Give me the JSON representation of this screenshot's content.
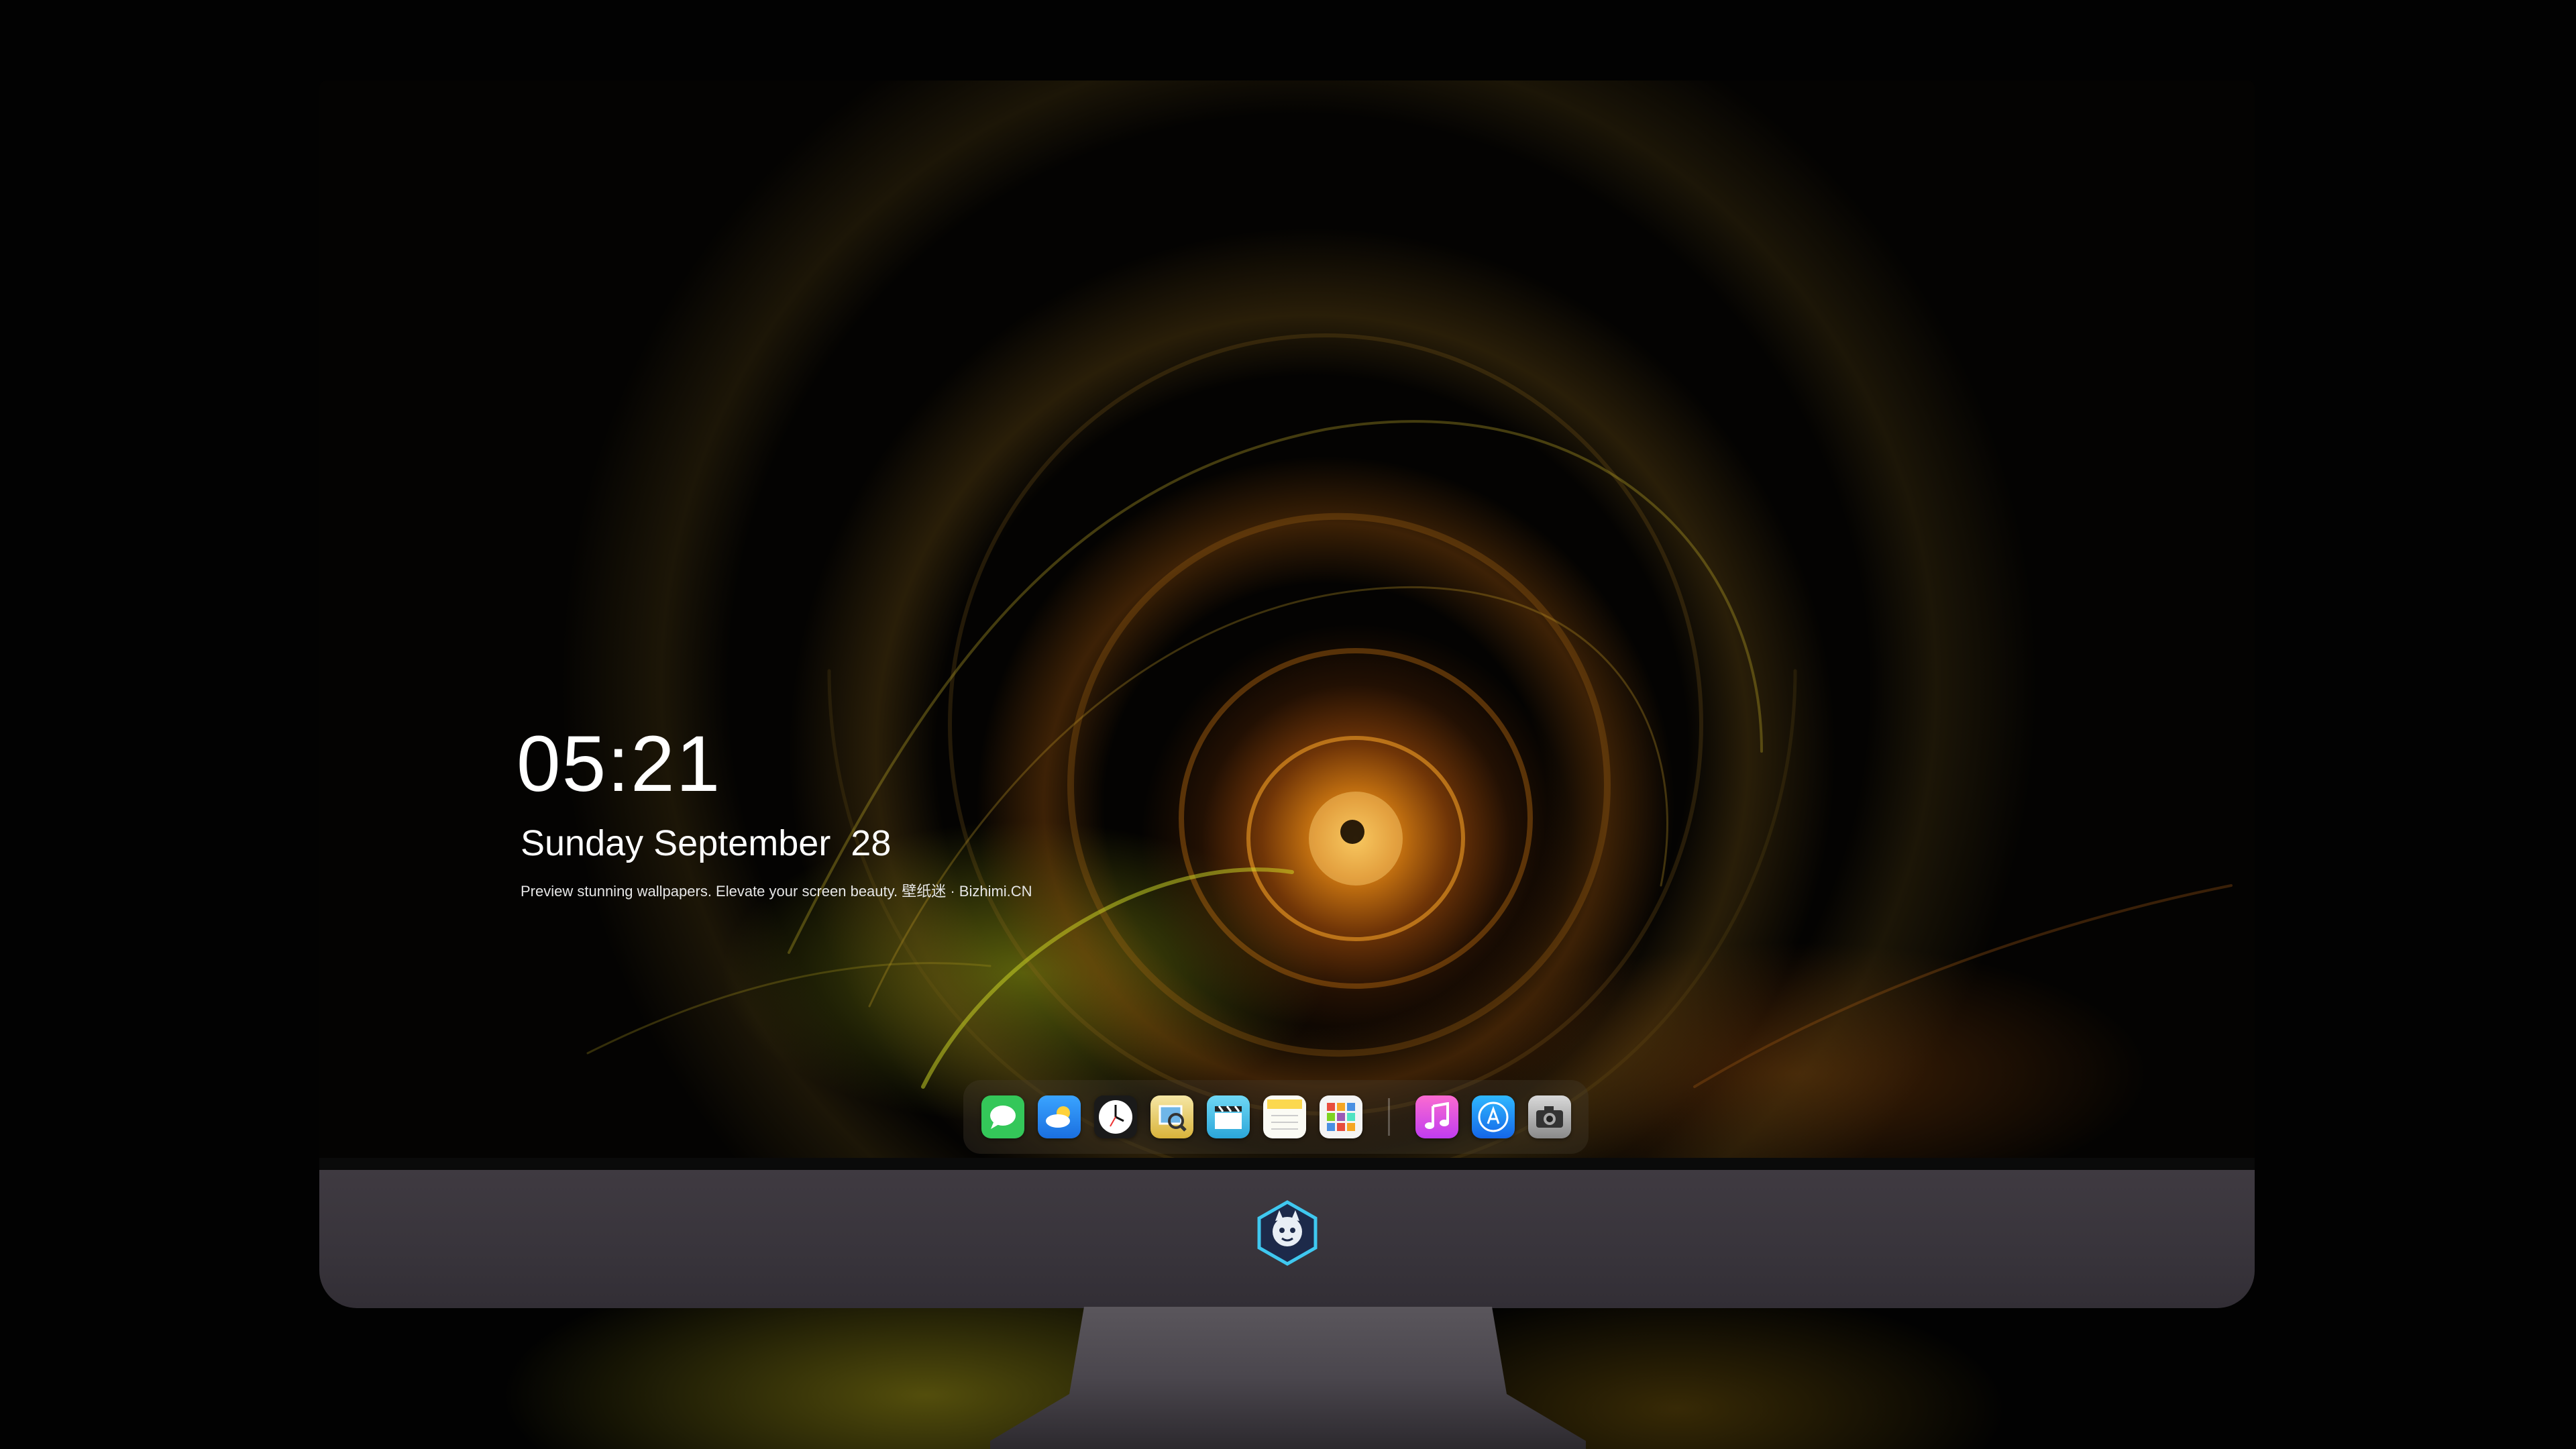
{
  "lock_screen": {
    "time": "05:21",
    "date": "Sunday September  28",
    "tagline": "Preview stunning wallpapers. Elevate your screen beauty. 壁纸迷 · Bizhimi.CN"
  },
  "dock": {
    "apps": [
      {
        "name": "messages",
        "icon": "chat-bubble-icon",
        "color": "#34c759",
        "glyph": "💬"
      },
      {
        "name": "weather",
        "icon": "cloud-icon",
        "color": "#2a8cf0",
        "glyph": "☁"
      },
      {
        "name": "clock",
        "icon": "clock-icon",
        "color": "#f2f2f2",
        "glyph": "🕓"
      },
      {
        "name": "preview",
        "icon": "magnifier-photo-icon",
        "color": "#e8c84a",
        "glyph": "🔍"
      },
      {
        "name": "clips",
        "icon": "clapperboard-icon",
        "color": "#4bc3e8",
        "glyph": "🎬"
      },
      {
        "name": "notes",
        "icon": "notes-icon",
        "color": "#fbd84e",
        "glyph": "≡"
      },
      {
        "name": "calendar-gallery",
        "icon": "grid-icon",
        "color": "#f4f4f4",
        "glyph": "▦"
      },
      {
        "name": "music",
        "icon": "music-note-icon",
        "color": "#f04fb0",
        "glyph": "♫"
      },
      {
        "name": "app-store",
        "icon": "app-store-icon",
        "color": "#1e8cf5",
        "glyph": "Ⓐ"
      },
      {
        "name": "camera",
        "icon": "camera-icon",
        "color": "#7a7a7a",
        "glyph": "◉"
      }
    ]
  },
  "colors": {
    "bezel": "#3f3a41",
    "wallpaper_accent": "#e0a020"
  }
}
